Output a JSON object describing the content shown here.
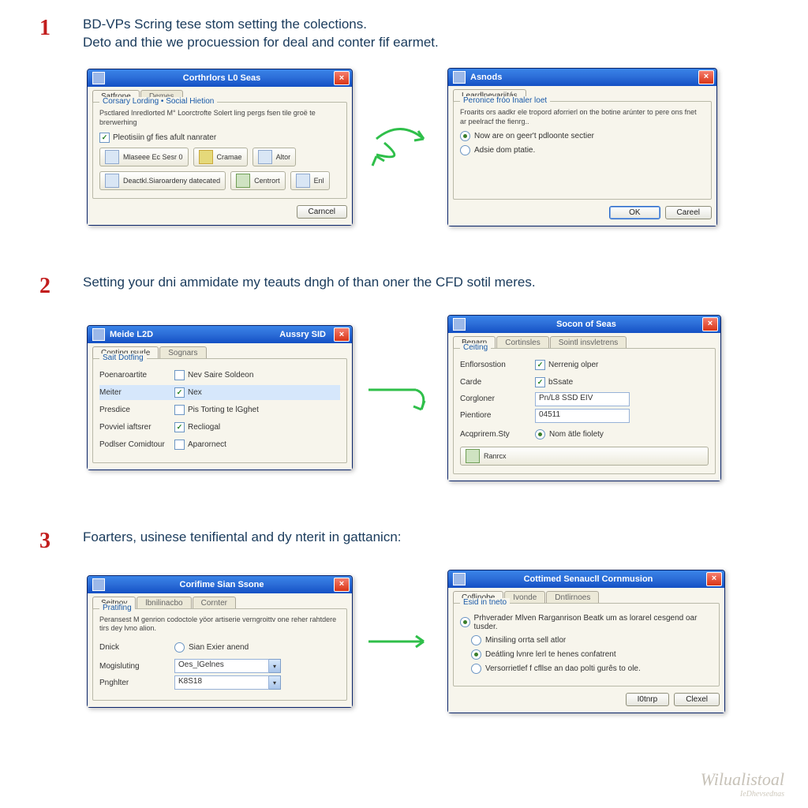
{
  "steps": [
    {
      "num": "1",
      "text_l1": "BD-VPs Scring tese stom setting the colections.",
      "text_l2": "Deto and thie we procuession for deal and conter fif earmet.",
      "dlg_a": {
        "title": "Corthrlors L0 Seas",
        "tabs": [
          "Satfrone",
          "Demes"
        ],
        "legend": "Corsary Lording • Social Hietion",
        "desc": "Psctlared Inredlorted M° Loorctrofte Solert ling pergs fsen tile groë te brerwerhing",
        "check": "Pleotisiin gf fies afult nanrater",
        "btns": [
          {
            "label": "Mlaseee Ec Sesr 0",
            "cls": ""
          },
          {
            "label": "Cramae",
            "cls": "g"
          },
          {
            "label": "Altor",
            "cls": ""
          },
          {
            "label": "Deactkl.Siaroardeny datecated",
            "cls": ""
          },
          {
            "label": "Centrort",
            "cls": "b"
          },
          {
            "label": "Enl",
            "cls": ""
          }
        ],
        "footer_btn": "Carncel"
      },
      "dlg_b": {
        "title": "Asnods",
        "tab": "Leardlnevariitás",
        "legend": "Peronice fróo Inaler loet",
        "desc": "Froarits ors aadkr ele tropord aforrierl on the botine arúnter to pere ons fnet ar peelracf the fienrg..",
        "radios": [
          {
            "label": "Now are on geer't pdloonte sectier",
            "sel": true
          },
          {
            "label": "Adsie dom ptatie.",
            "sel": false
          }
        ],
        "ok": "OK",
        "cancel": "Careel"
      },
      "arrow": "curve"
    },
    {
      "num": "2",
      "text_l1": "Setting your dni ammidate my teauts dngh of than oner the CFD sotil meres.",
      "dlg_a": {
        "title_l": "Meide L2D",
        "title_r": "Aussry SID",
        "tabs": [
          "Conting rsurle",
          "Sognars"
        ],
        "legend": "Sait Dotfing",
        "rows": [
          {
            "lab": "Poenaroartite",
            "kind": "chk",
            "val": "Nev Saire Soldeon",
            "checked": false
          },
          {
            "lab": "Meiter",
            "kind": "chk",
            "val": "Nex",
            "checked": true,
            "hilite": true
          },
          {
            "lab": "Presdice",
            "kind": "chk",
            "val": "Pis Torting te lGghet",
            "checked": false
          },
          {
            "lab": "Povviel iaftsrer",
            "kind": "chk",
            "val": "Recliogal",
            "checked": true
          },
          {
            "lab": "Podlser Comidtour",
            "kind": "chk",
            "val": "Aparornect",
            "checked": false
          }
        ]
      },
      "dlg_b": {
        "title": "Socon of Seas",
        "tabs": [
          "Benarn",
          "Cortinsles",
          "Sointl insvletrens"
        ],
        "legend": "Ceiting",
        "rows": [
          {
            "lab": "Enflorsostion",
            "kind": "chk",
            "val": "Nerrenig olper",
            "checked": true
          },
          {
            "lab": "Carde",
            "kind": "chk",
            "val": "bSsate",
            "checked": true
          },
          {
            "lab": "Corgloner",
            "kind": "input",
            "val": "Pn/L8 SSD EIV"
          },
          {
            "lab": "Pientiore",
            "kind": "input",
            "val": "04511"
          },
          {
            "lab": "Acqprirem.Sty",
            "kind": "radio",
            "val": "Nom ätle fiolety",
            "checked": true
          }
        ],
        "apply": "Ranrcx"
      },
      "arrow": "curve2"
    },
    {
      "num": "3",
      "text_l1": "Foarters, usinese tenifiental and dy nterit in gattanicn:",
      "dlg_a": {
        "title": "Corifime Sian Ssone",
        "tabs": [
          "Seitnoy",
          "lbnilinacbo",
          "Cornter"
        ],
        "legend": "Pratifing",
        "desc": "Peransest M genrion codoctole yöor artiserie verngroittv one reher rahtdere tirs dey lvno alion.",
        "rows": [
          {
            "lab": "Dnick",
            "kind": "radio",
            "val": "Sian Exier anend",
            "checked": false
          },
          {
            "lab": "Mogisluting",
            "kind": "drop",
            "val": "Oes_lGelnes"
          },
          {
            "lab": "Pnghlter",
            "kind": "drop",
            "val": "K8S18"
          }
        ]
      },
      "dlg_b": {
        "title": "Cottimed Senaucll Cornmusion",
        "tabs": [
          "Coflinobe",
          "Ivonde",
          "Dntlirnoes"
        ],
        "legend": "Esid in tneto",
        "radios": [
          {
            "label": "Prhverader Mlven Rarganrison Beatk um as lorarel cesgend oar tusder.",
            "sel": true
          },
          {
            "label": "Minsiling orrta sell atlor",
            "sel": false
          },
          {
            "label": "Deátling lvnre lerl te henes confatrent",
            "sel": true
          },
          {
            "label": "Versorrietlef f cfllse an dao polti gurês to ole.",
            "sel": false
          }
        ],
        "ok": "I0tnrp",
        "cancel": "Clexel"
      },
      "arrow": "straight"
    }
  ],
  "watermark": {
    "main": "Wilualistoal",
    "sub": "IeDhevsednas"
  }
}
